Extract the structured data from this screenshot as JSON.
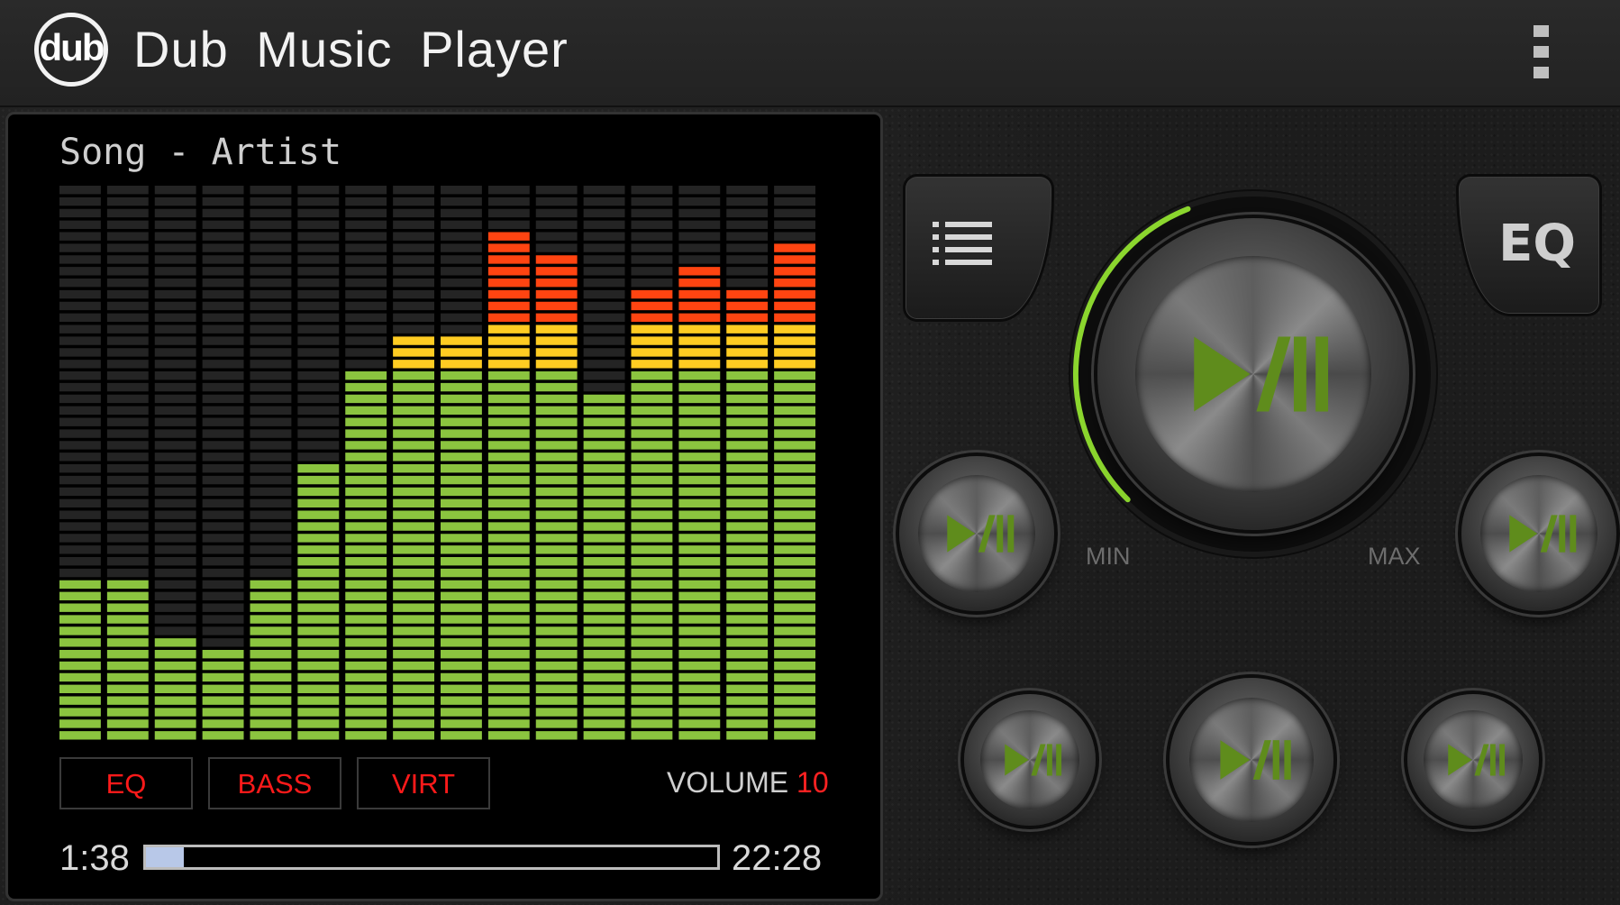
{
  "app": {
    "logo_text": "dub",
    "title": "Dub Music Player",
    "menu_icon": "overflow-menu-icon"
  },
  "player": {
    "song_line": "Song - Artist",
    "spectrum_levels": [
      14,
      14,
      9,
      8,
      14,
      24,
      32,
      35,
      35,
      44,
      42,
      30,
      39,
      41,
      39,
      43
    ],
    "spectrum_total_segments": 48,
    "spectrum_colors": {
      "low": "#8bc43f",
      "mid": "#ffcc22",
      "high": "#ff4411",
      "off": "#242424"
    },
    "buttons": {
      "eq": "EQ",
      "bass": "BASS",
      "virt": "VIRT"
    },
    "volume_label": "VOLUME",
    "volume_value": "10",
    "elapsed": "1:38",
    "total": "22:28",
    "progress_fraction": 0.066
  },
  "controls": {
    "playlist_icon": "playlist-icon",
    "eq_label": "EQ",
    "volume_min": "MIN",
    "volume_max": "MAX",
    "volume_knob_fraction": 0.42,
    "accent_color": "#8bd62e",
    "play_pause_icon": "play-pause-icon"
  }
}
